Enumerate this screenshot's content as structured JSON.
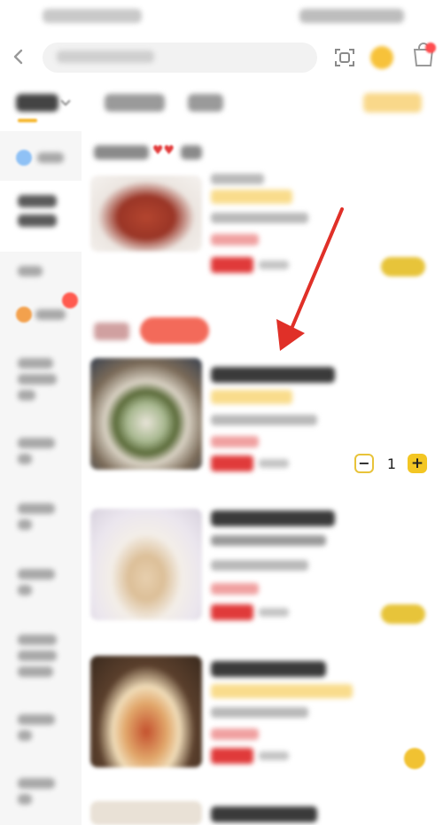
{
  "stepper": {
    "minus_label": "−",
    "quantity": "1",
    "plus_label": "+"
  },
  "colors": {
    "accent_yellow": "#f3c623",
    "price_red": "#e03a3a",
    "annotation_arrow": "#e03028"
  },
  "icons": {
    "back": "back-icon",
    "scan": "scan-icon",
    "star": "star-icon",
    "cart": "cart-icon",
    "hearts": "heart-icon"
  }
}
